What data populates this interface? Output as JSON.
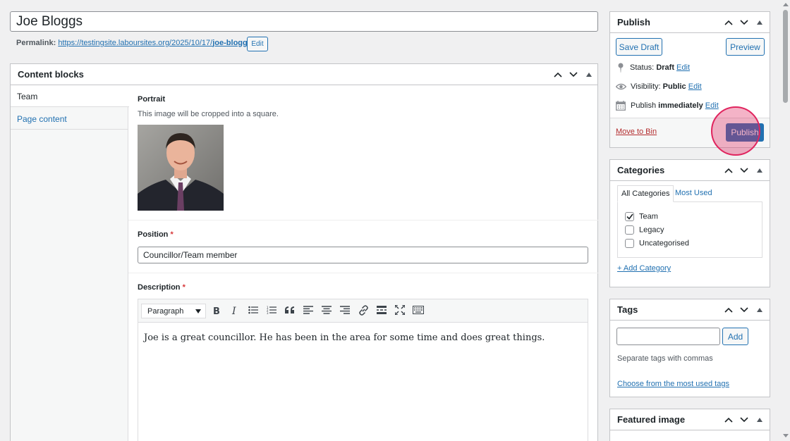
{
  "title": {
    "value": "Joe Bloggs"
  },
  "permalink": {
    "label": "Permalink:",
    "url_base": "https://testingsite.laboursites.org/2025/10/17/",
    "url_slug": "joe-bloggs",
    "url_trail": "/",
    "edit_label": "Edit"
  },
  "content_blocks": {
    "title": "Content blocks",
    "tabs": [
      {
        "label": "Team",
        "active": true
      },
      {
        "label": "Page content",
        "active": false
      }
    ],
    "portrait": {
      "label": "Portrait",
      "hint": "This image will be cropped into a square."
    },
    "position": {
      "label": "Position",
      "required": "*",
      "value": "Councillor/Team member"
    },
    "description": {
      "label": "Description",
      "required": "*",
      "format_select": "Paragraph",
      "body": "Joe is a great councillor. He has been in the area for some time and does great things."
    }
  },
  "publish": {
    "title": "Publish",
    "save_draft": "Save Draft",
    "preview": "Preview",
    "status_label": "Status:",
    "status_value": "Draft",
    "visibility_label": "Visibility:",
    "visibility_value": "Public",
    "schedule_label": "Publish",
    "schedule_value": "immediately",
    "edit": "Edit",
    "move_to_bin": "Move to Bin",
    "publish_button": "Publish"
  },
  "categories": {
    "title": "Categories",
    "tab_all": "All Categories",
    "tab_most_used": "Most Used",
    "items": [
      {
        "label": "Team",
        "checked": true
      },
      {
        "label": "Legacy",
        "checked": false
      },
      {
        "label": "Uncategorised",
        "checked": false
      }
    ],
    "add_link": "+ Add Category"
  },
  "tags": {
    "title": "Tags",
    "add_button": "Add",
    "hint": "Separate tags with commas",
    "choose_link": "Choose from the most used tags"
  },
  "featured_image": {
    "title": "Featured image"
  },
  "colors": {
    "accent": "#2271b1",
    "danger": "#b32d2e",
    "highlight": "#e0245e"
  }
}
